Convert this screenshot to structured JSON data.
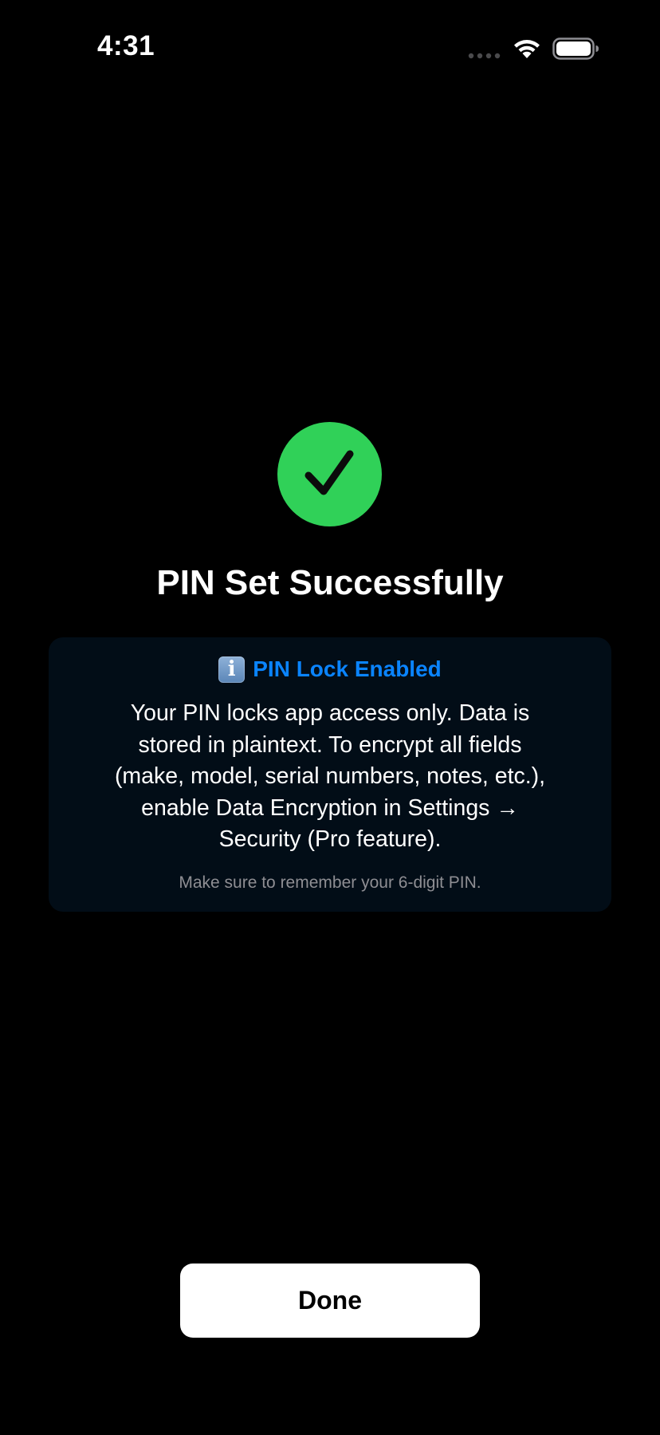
{
  "status_bar": {
    "time": "4:31"
  },
  "icons": {
    "signal": "cellular-signal-icon",
    "wifi": "wifi-icon",
    "battery": "battery-icon",
    "success": "checkmark-circle-icon",
    "info": "info-icon"
  },
  "main": {
    "title": "PIN Set Successfully"
  },
  "info_card": {
    "icon_glyph": "i",
    "title": "PIN Lock Enabled",
    "body": "Your PIN locks app access only. Data is stored in plaintext. To encrypt all fields (make, model, serial numbers, notes, etc.), enable Data Encryption in Settings → Security (Pro feature).",
    "note": "Make sure to remember your 6-digit PIN."
  },
  "actions": {
    "done_label": "Done"
  },
  "colors": {
    "background": "#000000",
    "success_green": "#30d158",
    "accent_blue": "#0a84ff",
    "card_background": "#020d17",
    "secondary_text": "#8e8e93"
  }
}
